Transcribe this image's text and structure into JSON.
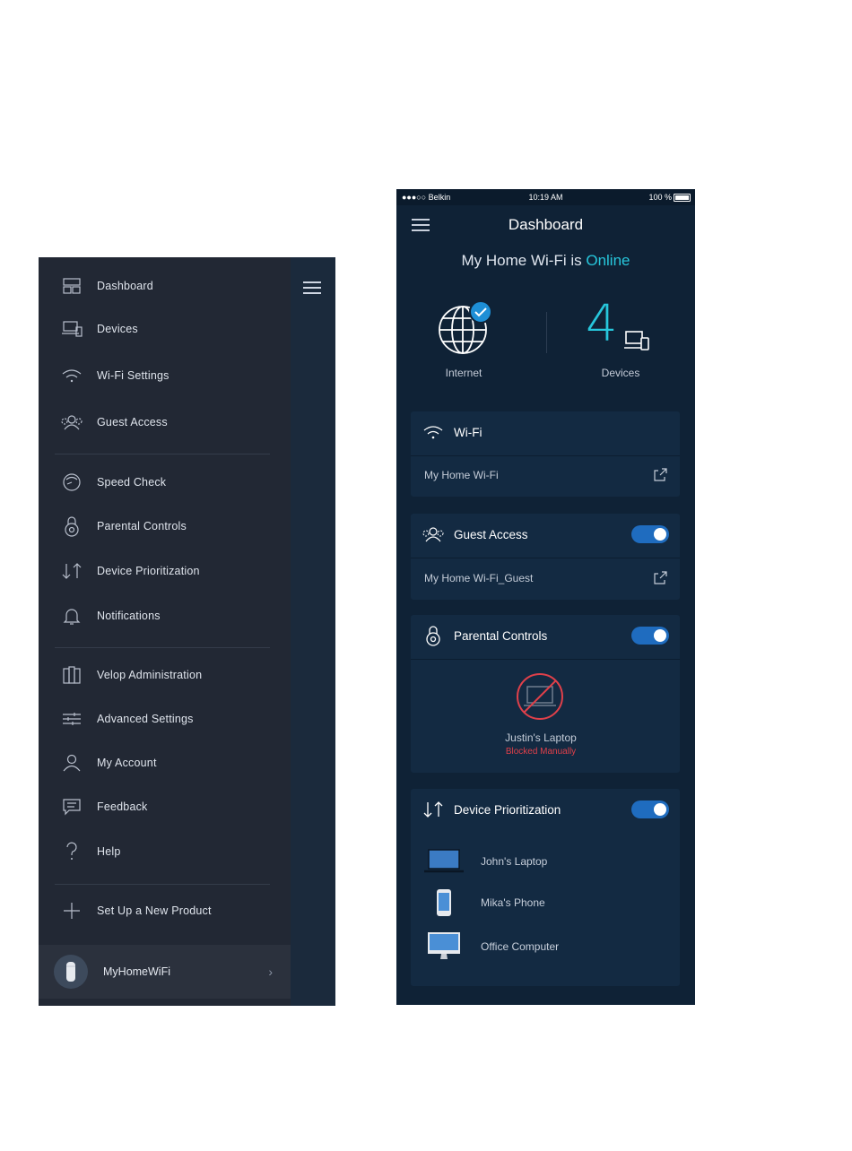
{
  "menu": {
    "items": [
      {
        "label": "Dashboard",
        "icon": "dashboard-icon"
      },
      {
        "label": "Devices",
        "icon": "devices-icon"
      },
      {
        "label": "Wi-Fi Settings",
        "icon": "wifi-icon"
      },
      {
        "label": "Guest Access",
        "icon": "guest-access-icon"
      },
      {
        "label": "Speed Check",
        "icon": "speedometer-icon"
      },
      {
        "label": "Parental Controls",
        "icon": "padlock-icon"
      },
      {
        "label": "Device Prioritization",
        "icon": "prioritization-arrows-icon"
      },
      {
        "label": "Notifications",
        "icon": "bell-icon"
      },
      {
        "label": "Velop Administration",
        "icon": "velop-nodes-icon"
      },
      {
        "label": "Advanced Settings",
        "icon": "sliders-icon"
      },
      {
        "label": "My Account",
        "icon": "user-icon"
      },
      {
        "label": "Feedback",
        "icon": "feedback-icon"
      },
      {
        "label": "Help",
        "icon": "help-icon"
      },
      {
        "label": "Set Up a New Product",
        "icon": "plus-icon"
      }
    ],
    "network_name": "MyHomeWiFi"
  },
  "status_bar": {
    "carrier": "●●●○○ Belkin",
    "time": "10:19 AM",
    "battery": "100 %"
  },
  "dashboard": {
    "title": "Dashboard",
    "network_prefix": "My Home Wi-Fi is ",
    "network_status": "Online",
    "internet_label": "Internet",
    "devices_count": "4",
    "devices_label": "Devices",
    "wifi_card": {
      "title": "Wi-Fi",
      "network": "My Home Wi-Fi"
    },
    "guest_card": {
      "title": "Guest Access",
      "network": "My Home Wi-Fi_Guest",
      "enabled": true
    },
    "parental_card": {
      "title": "Parental Controls",
      "enabled": true,
      "blocked_device": "Justin's Laptop",
      "blocked_status": "Blocked Manually"
    },
    "prioritization_card": {
      "title": "Device Prioritization",
      "enabled": true,
      "devices": [
        {
          "name": "John's Laptop",
          "icon": "laptop-icon"
        },
        {
          "name": "Mika's Phone",
          "icon": "phone-icon"
        },
        {
          "name": "Office Computer",
          "icon": "desktop-computer-icon"
        }
      ]
    }
  },
  "colors": {
    "accent": "#27c7dc",
    "toggle_on": "#1f6cbf",
    "blocked": "#e0404a",
    "background": "#0f2236",
    "menu_background": "#222834"
  }
}
